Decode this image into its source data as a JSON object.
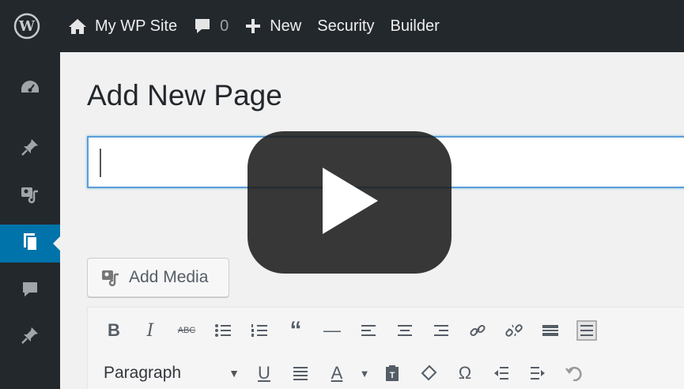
{
  "adminbar": {
    "site_name": "My WP Site",
    "comments_count": "0",
    "new_label": "New",
    "security_label": "Security",
    "builder_label": "Builder"
  },
  "menu": [
    {
      "icon": "dashboard-icon"
    },
    {
      "icon": "pin-icon"
    },
    {
      "icon": "media-icon"
    },
    {
      "icon": "pages-icon",
      "active": true
    },
    {
      "icon": "comment-icon"
    },
    {
      "icon": "pin-icon"
    }
  ],
  "main": {
    "page_title": "Add New Page",
    "title_value": "",
    "add_media_label": "Add Media",
    "format_select_value": "Paragraph"
  },
  "toolbar": {
    "row1": [
      "B",
      "I",
      "ABC",
      "bullet-list",
      "numbered-list",
      "“",
      "—",
      "align-left",
      "align-center",
      "align-right",
      "link",
      "unlink",
      "read-more",
      "toolbar-toggle"
    ],
    "row2": [
      "U",
      "justify",
      "A",
      "paste-text",
      "clear-formatting",
      "Ω",
      "outdent",
      "indent",
      "undo"
    ]
  },
  "colors": {
    "adminbar_bg": "#23282d",
    "active_menu": "#0073aa",
    "content_bg": "#f1f1f1",
    "focus_border": "#5b9dd9",
    "play_bg": "#1c1c1c"
  }
}
